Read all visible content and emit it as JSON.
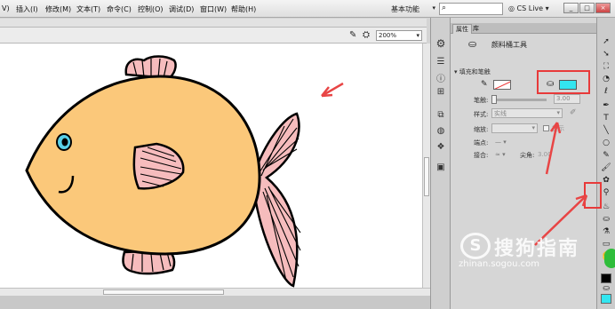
{
  "menu": {
    "items": [
      "V)",
      "插入(I)",
      "修改(M)",
      "文本(T)",
      "命令(C)",
      "控制(O)",
      "调试(D)",
      "窗口(W)",
      "帮助(H)"
    ],
    "workspace": "基本功能",
    "search_placeholder": "",
    "cs_live": "CS Live",
    "win_min": "_",
    "win_max": "□",
    "win_close": "×"
  },
  "stage": {
    "zoom": "200%"
  },
  "props": {
    "tabs": [
      "属性",
      "库"
    ],
    "tool_title": "颜料桶工具",
    "section": "填充和笔触",
    "stroke_label": "笔触:",
    "stroke_value": "3.00",
    "style_label": "样式:",
    "style_value": "实线",
    "scale_label": "缩放:",
    "hint_label": "提示",
    "cap_label": "端点:",
    "join_label": "接合:",
    "miter_label": "尖角:",
    "miter_value": "3.00"
  },
  "colors": {
    "fill": "#33e6f0",
    "fish_body": "#fbc87a",
    "fin": "#f6bcbd",
    "arrow": "#e84545",
    "stroke_color": "#000000"
  },
  "watermark": {
    "text": "搜狗指南",
    "logo_letter": "S",
    "url": "zhinan.sogou.com"
  }
}
